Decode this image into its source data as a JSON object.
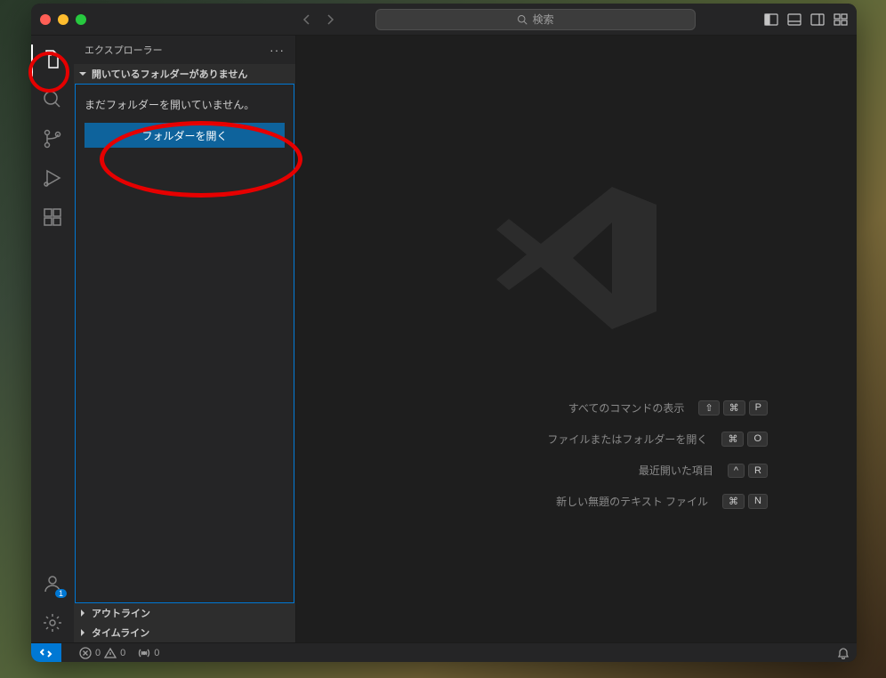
{
  "titlebar": {
    "search_placeholder": "検索"
  },
  "sidebar": {
    "title": "エクスプローラー",
    "sections": {
      "no_folder_header": "開いているフォルダーがありません",
      "outline": "アウトライン",
      "timeline": "タイムライン"
    },
    "open_area": {
      "message": "まだフォルダーを開いていません。",
      "button": "フォルダーを開く"
    }
  },
  "accounts_badge": "1",
  "hints": [
    {
      "label": "すべてのコマンドの表示",
      "keys": [
        "⇧",
        "⌘",
        "P"
      ]
    },
    {
      "label": "ファイルまたはフォルダーを開く",
      "keys": [
        "⌘",
        "O"
      ]
    },
    {
      "label": "最近開いた項目",
      "keys": [
        "^",
        "R"
      ]
    },
    {
      "label": "新しい無題のテキスト ファイル",
      "keys": [
        "⌘",
        "N"
      ]
    }
  ],
  "statusbar": {
    "errors": "0",
    "warnings": "0",
    "ports": "0"
  }
}
